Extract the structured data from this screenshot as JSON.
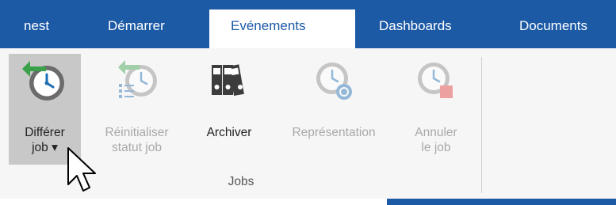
{
  "tabs": [
    {
      "label": "nest",
      "active": false
    },
    {
      "label": "Démarrer",
      "active": false
    },
    {
      "label": "Evénements",
      "active": true
    },
    {
      "label": "Dashboards",
      "active": false
    },
    {
      "label": "Documents",
      "active": false
    }
  ],
  "ribbon": {
    "group_label": "Jobs",
    "buttons": [
      {
        "line1": "Différer",
        "line2": "job ▾",
        "enabled": true,
        "icon": "clock-back-arrow-icon"
      },
      {
        "line1": "Réinitialiser",
        "line2": "statut job",
        "enabled": false,
        "icon": "clock-list-icon"
      },
      {
        "line1": "Archiver",
        "line2": "",
        "enabled": true,
        "icon": "binders-icon"
      },
      {
        "line1": "Représentation",
        "line2": "",
        "enabled": false,
        "icon": "clock-refresh-icon"
      },
      {
        "line1": "Annuler",
        "line2": "le job",
        "enabled": false,
        "icon": "clock-cancel-icon"
      }
    ]
  },
  "colors": {
    "tabbar": "#1c5aa6",
    "ribbon": "#f6f6f6",
    "disabled_text": "#a9a9a9",
    "accent_green": "#3aa04a"
  }
}
